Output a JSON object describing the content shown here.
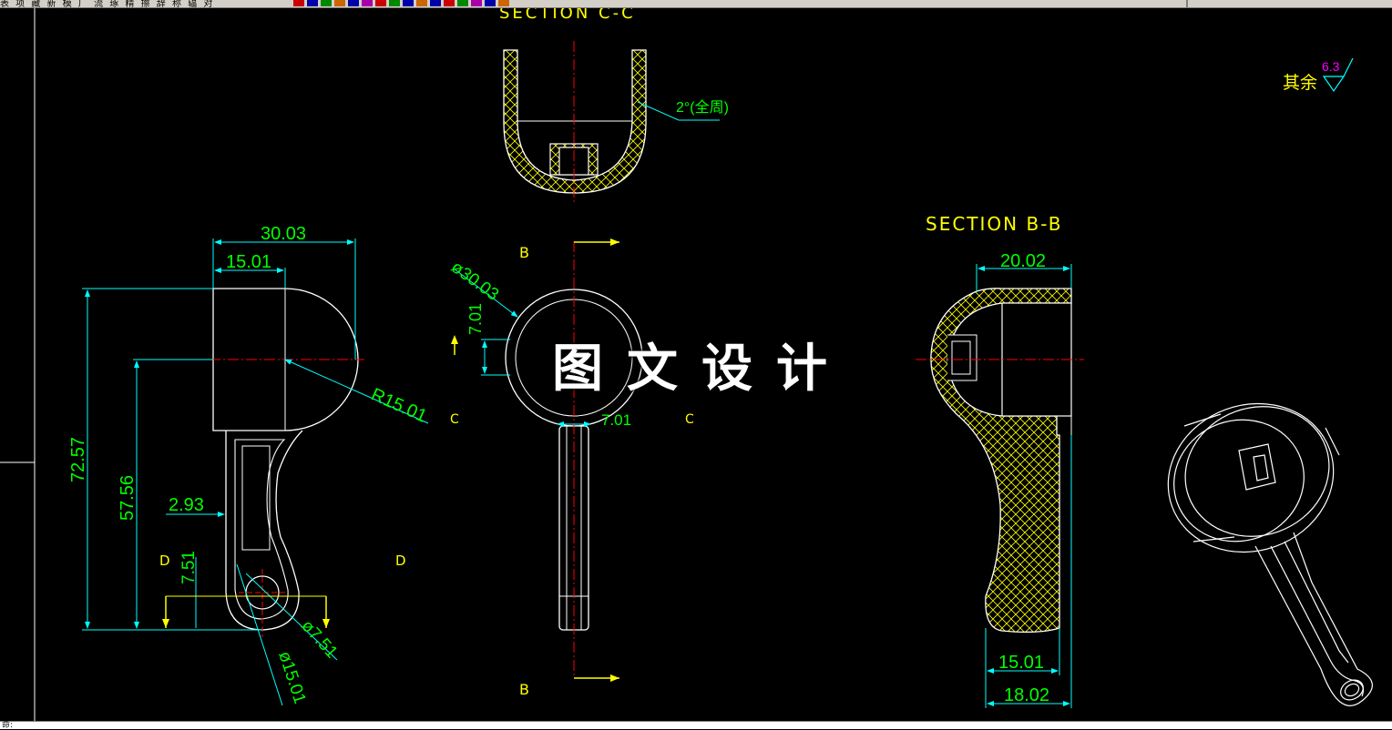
{
  "window": {
    "menu_text": "表 项 藏 新 模 厂 流 琢 精 擦 辞 称 辐 对",
    "status_text": "命:"
  },
  "colors": {
    "background": "#000000",
    "outline": "#ffffff",
    "dimension": "#00ffff",
    "dimension_text": "#00ff00",
    "hatch": "#ffff00",
    "centerline": "#ff0000",
    "section_label": "#ffff00",
    "surface_sym": "#ff00ff"
  },
  "drawing": {
    "section_cc_title": "SECTION C-C",
    "section_bb_title": "SECTION B-B",
    "roughness_note": "其余",
    "roughness_value": "6.3",
    "draft_note": "2°(全周)",
    "labels": {
      "b_top": "B",
      "b_bottom": "B",
      "c_left": "C",
      "c_right": "C",
      "d_left": "D",
      "d_right": "D"
    },
    "dims": {
      "width_30": "30.03",
      "width_15": "15.01",
      "height_72": "72.57",
      "height_57": "57.56",
      "wall_2": "2.93",
      "radius": "R15.01",
      "hole_7": "7.51",
      "dia_7": "ø7.51",
      "dia_15": "ø15.01",
      "dia_30": "ø30.03",
      "front_7": "7.01",
      "front_bottom": "7.01",
      "bb_20": "20.02",
      "bb_15": "15.01",
      "bb_18": "18.02"
    }
  },
  "watermark": "图文设计"
}
